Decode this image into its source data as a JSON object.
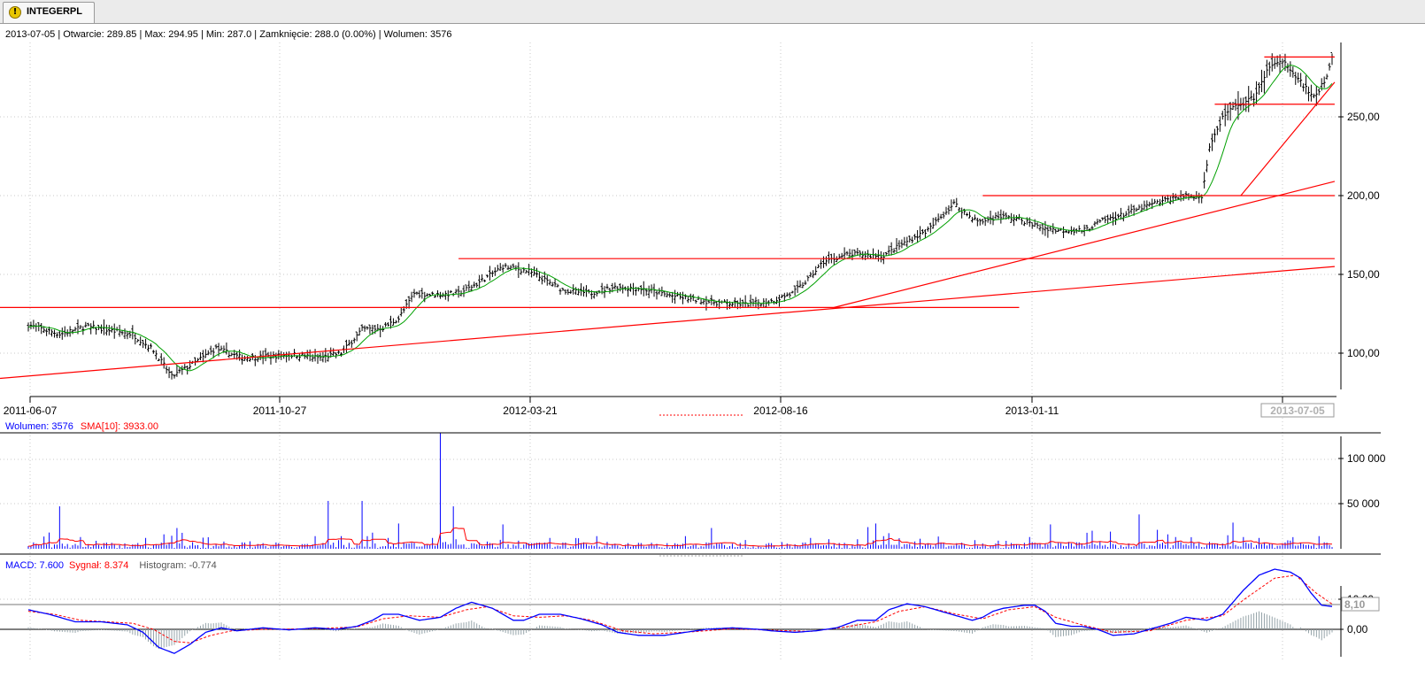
{
  "tab": {
    "label": "INTEGERPL",
    "icon": "warning-icon"
  },
  "info_line": "2013-07-05 | Otwarcie: 289.85 | Max: 294.95 | Min: 287.0 | Zamknięcie: 288.0 (0.00%)  | Wolumen: 3576",
  "colors": {
    "bar": "#000000",
    "sma_price": "#00a000",
    "lines": "#ff0000",
    "volume": "#0000ff",
    "volume_sma": "#ff0000",
    "macd": "#0000ff",
    "signal": "#ff0000",
    "histogram": "#8a9aa0",
    "grid": "#c8c8c8"
  },
  "chart_data": [
    {
      "type": "ohlc",
      "panel": "price",
      "x_ticks": [
        "2011-06-07",
        "2011-10-27",
        "2012-03-21",
        "2012-08-16",
        "2013-01-11"
      ],
      "x_cursor_label": "2013-07-05",
      "y_ticks": [
        "100,00",
        "150,00",
        "200,00",
        "250,00"
      ],
      "ylim": [
        75,
        300
      ],
      "grid": true,
      "close_path": [
        [
          0,
          118
        ],
        [
          12,
          112
        ],
        [
          22,
          117
        ],
        [
          40,
          112
        ],
        [
          48,
          102
        ],
        [
          55,
          85
        ],
        [
          62,
          92
        ],
        [
          72,
          103
        ],
        [
          82,
          97
        ],
        [
          92,
          98
        ],
        [
          102,
          99
        ],
        [
          112,
          97
        ],
        [
          120,
          100
        ],
        [
          128,
          115
        ],
        [
          136,
          116
        ],
        [
          142,
          122
        ],
        [
          148,
          138
        ],
        [
          155,
          137
        ],
        [
          165,
          138
        ],
        [
          172,
          144
        ],
        [
          182,
          155
        ],
        [
          192,
          152
        ],
        [
          205,
          140
        ],
        [
          215,
          138
        ],
        [
          225,
          142
        ],
        [
          235,
          141
        ],
        [
          245,
          137
        ],
        [
          255,
          134
        ],
        [
          265,
          132
        ],
        [
          275,
          131
        ],
        [
          285,
          133
        ],
        [
          293,
          138
        ],
        [
          298,
          145
        ],
        [
          305,
          158
        ],
        [
          315,
          163
        ],
        [
          322,
          162
        ],
        [
          328,
          162
        ],
        [
          338,
          172
        ],
        [
          345,
          178
        ],
        [
          352,
          190
        ],
        [
          355,
          195
        ],
        [
          360,
          188
        ],
        [
          365,
          183
        ],
        [
          372,
          187
        ],
        [
          380,
          185
        ],
        [
          388,
          180
        ],
        [
          395,
          178
        ],
        [
          405,
          178
        ],
        [
          412,
          184
        ],
        [
          420,
          188
        ],
        [
          428,
          193
        ],
        [
          436,
          197
        ],
        [
          442,
          200
        ],
        [
          446,
          199
        ],
        [
          450,
          200
        ],
        [
          453,
          230
        ],
        [
          458,
          250
        ],
        [
          462,
          255
        ],
        [
          470,
          262
        ],
        [
          476,
          282
        ],
        [
          482,
          285
        ],
        [
          488,
          272
        ],
        [
          493,
          262
        ],
        [
          498,
          275
        ],
        [
          500,
          288
        ]
      ],
      "n_bars": 501,
      "sma_label": "SMA[10]",
      "lines": [
        {
          "kind": "horizontal",
          "y": 129,
          "x": [
            0,
            380
          ]
        },
        {
          "kind": "horizontal",
          "y": 160,
          "x": [
            165,
            501
          ]
        },
        {
          "kind": "horizontal",
          "y": 200,
          "x": [
            366,
            501
          ]
        },
        {
          "kind": "horizontal",
          "y": 258,
          "x": [
            455,
            501
          ]
        },
        {
          "kind": "horizontal",
          "y": 288,
          "x": [
            474,
            501
          ]
        },
        {
          "kind": "trend",
          "from": [
            0,
            84
          ],
          "to": [
            501,
            155
          ]
        },
        {
          "kind": "trend",
          "from": [
            309,
            129
          ],
          "to": [
            501,
            209
          ]
        },
        {
          "kind": "trend",
          "from": [
            465,
            200
          ],
          "to": [
            501,
            272
          ]
        }
      ]
    },
    {
      "type": "bar",
      "panel": "volume",
      "series_names": [
        "Wolumen",
        "SMA[10]"
      ],
      "current": {
        "volume": "3576",
        "sma": "3933.00"
      },
      "y_ticks": [
        "50 000",
        "100 000"
      ],
      "ylim": [
        0,
        130000
      ],
      "avg_volume": 4000,
      "spikes": [
        [
          8,
          18000
        ],
        [
          12,
          47000
        ],
        [
          20,
          13000
        ],
        [
          45,
          12000
        ],
        [
          52,
          16000
        ],
        [
          57,
          23000
        ],
        [
          75,
          8000
        ],
        [
          95,
          7000
        ],
        [
          110,
          14000
        ],
        [
          115,
          53000
        ],
        [
          120,
          14000
        ],
        [
          130,
          14000
        ],
        [
          128,
          53000
        ],
        [
          138,
          12000
        ],
        [
          142,
          28000
        ],
        [
          155,
          12000
        ],
        [
          158,
          128000
        ],
        [
          163,
          47000
        ],
        [
          176,
          8000
        ],
        [
          182,
          27000
        ],
        [
          188,
          9000
        ],
        [
          200,
          12000
        ],
        [
          218,
          14000
        ],
        [
          252,
          14000
        ],
        [
          262,
          23000
        ],
        [
          300,
          12000
        ],
        [
          322,
          24000
        ],
        [
          325,
          28000
        ],
        [
          328,
          14000
        ],
        [
          372,
          9000
        ],
        [
          384,
          13000
        ],
        [
          392,
          27000
        ],
        [
          408,
          20000
        ],
        [
          415,
          19000
        ],
        [
          426,
          38000
        ],
        [
          433,
          21000
        ],
        [
          440,
          13000
        ],
        [
          460,
          15000
        ],
        [
          462,
          29000
        ],
        [
          466,
          13000
        ],
        [
          472,
          12000
        ],
        [
          484,
          9000
        ],
        [
          495,
          14000
        ]
      ]
    },
    {
      "type": "line",
      "panel": "macd",
      "series_names": [
        "MACD",
        "Sygnał",
        "Histogram"
      ],
      "current": {
        "macd": "7.600",
        "signal": "8.374",
        "histogram": "-0.774"
      },
      "y_ticks": [
        "0,00",
        "10,00"
      ],
      "marker_label": "8,10",
      "ylim": [
        -10,
        20
      ],
      "macd_path": [
        [
          0,
          6.5
        ],
        [
          8,
          5
        ],
        [
          18,
          2.5
        ],
        [
          28,
          2.5
        ],
        [
          38,
          1.5
        ],
        [
          44,
          -1
        ],
        [
          50,
          -6
        ],
        [
          56,
          -8
        ],
        [
          62,
          -5
        ],
        [
          68,
          -1
        ],
        [
          74,
          0.5
        ],
        [
          80,
          -0.5
        ],
        [
          90,
          0.5
        ],
        [
          100,
          -0.2
        ],
        [
          110,
          0.5
        ],
        [
          118,
          0
        ],
        [
          126,
          1
        ],
        [
          132,
          3
        ],
        [
          136,
          5
        ],
        [
          142,
          5
        ],
        [
          150,
          3
        ],
        [
          158,
          4
        ],
        [
          164,
          7
        ],
        [
          170,
          9
        ],
        [
          178,
          7
        ],
        [
          186,
          3
        ],
        [
          190,
          3
        ],
        [
          196,
          5
        ],
        [
          204,
          5
        ],
        [
          212,
          3.5
        ],
        [
          220,
          1.5
        ],
        [
          226,
          -1
        ],
        [
          234,
          -2
        ],
        [
          244,
          -2
        ],
        [
          252,
          -1
        ],
        [
          260,
          0
        ],
        [
          270,
          0.5
        ],
        [
          280,
          0
        ],
        [
          285,
          -0.5
        ],
        [
          294,
          -1
        ],
        [
          302,
          -0.5
        ],
        [
          310,
          0.5
        ],
        [
          318,
          3
        ],
        [
          325,
          3
        ],
        [
          330,
          6.5
        ],
        [
          337,
          8.5
        ],
        [
          344,
          7.5
        ],
        [
          350,
          6
        ],
        [
          356,
          4.5
        ],
        [
          362,
          3
        ],
        [
          366,
          4
        ],
        [
          370,
          6
        ],
        [
          374,
          7
        ],
        [
          378,
          7.5
        ],
        [
          382,
          8
        ],
        [
          386,
          8
        ],
        [
          390,
          6
        ],
        [
          394,
          2
        ],
        [
          400,
          1
        ],
        [
          404,
          1
        ],
        [
          410,
          0
        ],
        [
          416,
          -2
        ],
        [
          424,
          -1.5
        ],
        [
          430,
          0
        ],
        [
          438,
          2
        ],
        [
          444,
          4
        ],
        [
          452,
          3
        ],
        [
          458,
          5
        ],
        [
          466,
          13
        ],
        [
          472,
          18
        ],
        [
          478,
          20
        ],
        [
          484,
          19
        ],
        [
          488,
          17
        ],
        [
          492,
          12
        ],
        [
          496,
          8
        ],
        [
          500,
          7.6
        ]
      ],
      "signal_path": [
        [
          0,
          6
        ],
        [
          10,
          5
        ],
        [
          20,
          3
        ],
        [
          30,
          2.5
        ],
        [
          40,
          2
        ],
        [
          48,
          0
        ],
        [
          56,
          -4
        ],
        [
          62,
          -4.5
        ],
        [
          70,
          -2
        ],
        [
          78,
          -0.5
        ],
        [
          90,
          0
        ],
        [
          110,
          0.2
        ],
        [
          126,
          0.8
        ],
        [
          136,
          3.5
        ],
        [
          146,
          4.5
        ],
        [
          158,
          4
        ],
        [
          168,
          6.5
        ],
        [
          176,
          7.5
        ],
        [
          186,
          4.5
        ],
        [
          196,
          4
        ],
        [
          206,
          4.5
        ],
        [
          216,
          3
        ],
        [
          228,
          -0.5
        ],
        [
          240,
          -1.5
        ],
        [
          255,
          -0.8
        ],
        [
          270,
          0.2
        ],
        [
          285,
          -0.3
        ],
        [
          300,
          -0.7
        ],
        [
          312,
          0.6
        ],
        [
          325,
          2.5
        ],
        [
          334,
          6
        ],
        [
          344,
          7.5
        ],
        [
          356,
          5
        ],
        [
          366,
          3.5
        ],
        [
          376,
          6.5
        ],
        [
          386,
          7.5
        ],
        [
          394,
          4
        ],
        [
          404,
          1.5
        ],
        [
          416,
          -1
        ],
        [
          430,
          -0.5
        ],
        [
          444,
          3
        ],
        [
          458,
          4.5
        ],
        [
          468,
          11
        ],
        [
          478,
          17
        ],
        [
          486,
          18
        ],
        [
          494,
          12
        ],
        [
          500,
          8.4
        ]
      ]
    }
  ]
}
